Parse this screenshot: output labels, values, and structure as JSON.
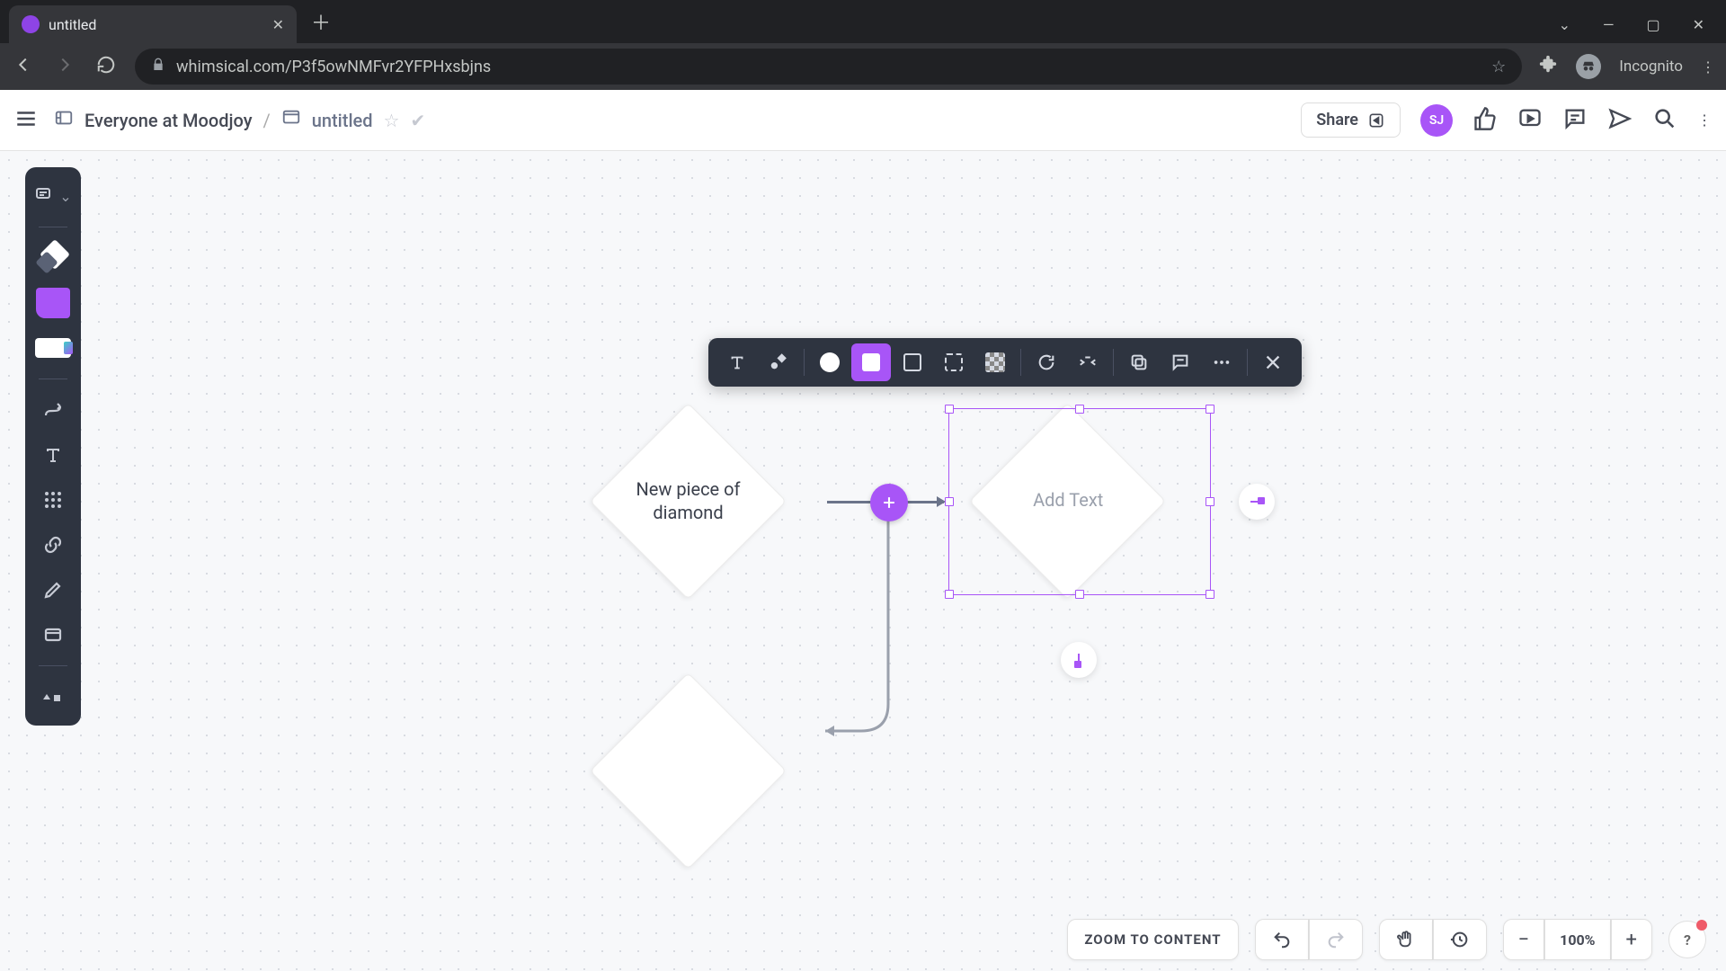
{
  "browser": {
    "tab_title": "untitled",
    "url": "whimsical.com/P3f5owNMFvr2YFPHxsbjns",
    "incognito_label": "Incognito"
  },
  "header": {
    "org": "Everyone at Moodjoy",
    "doc_title": "untitled",
    "share_label": "Share",
    "avatar_initials": "SJ"
  },
  "canvas": {
    "left_diamond_text": "New piece of diamond",
    "right_diamond_placeholder": "Add Text"
  },
  "bottom": {
    "zoom_to_content": "ZOOM TO CONTENT",
    "zoom_pct": "100%",
    "help": "?"
  }
}
